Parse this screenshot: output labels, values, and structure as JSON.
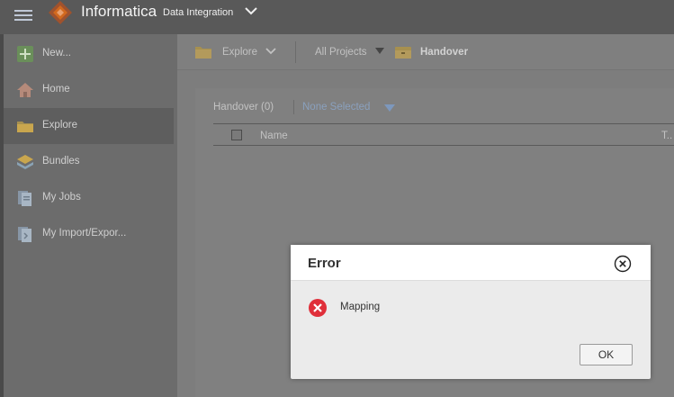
{
  "header": {
    "brand": "Informatica",
    "product": "Data Integration"
  },
  "sidebar": {
    "items": [
      {
        "label": "New..."
      },
      {
        "label": "Home"
      },
      {
        "label": "Explore"
      },
      {
        "label": "Bundles"
      },
      {
        "label": "My Jobs"
      },
      {
        "label": "My Import/Expor..."
      }
    ]
  },
  "toolbar": {
    "explore_label": "Explore",
    "project_filter": "All Projects",
    "folder_name": "Handover"
  },
  "list": {
    "title": "Handover (0)",
    "selection": "None Selected",
    "columns": [
      "Name",
      "T.."
    ]
  },
  "dialog": {
    "title": "Error",
    "message": "Mapping",
    "ok_label": "OK"
  },
  "colors": {
    "error_red": "#e02f3a",
    "folder_yellow": "#c9a64e"
  }
}
